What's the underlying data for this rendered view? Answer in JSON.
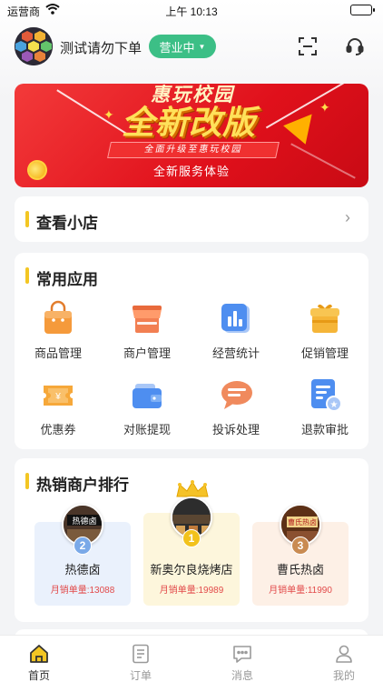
{
  "status_bar": {
    "carrier": "运营商",
    "time": "上午 10:13"
  },
  "header": {
    "store_name": "测试请勿下单",
    "status_label": "营业中"
  },
  "banner": {
    "title_top": "惠玩校园",
    "title_main": "全新改版",
    "ribbon": "全面升级至惠玩校园",
    "subtitle": "全新服务体验"
  },
  "shop_card": {
    "title": "查看小店"
  },
  "apps": {
    "title": "常用应用",
    "items": [
      {
        "label": "商品管理",
        "icon": "shopping-bag-icon"
      },
      {
        "label": "商户管理",
        "icon": "storefront-icon"
      },
      {
        "label": "经营统计",
        "icon": "bar-chart-icon"
      },
      {
        "label": "促销管理",
        "icon": "gift-box-icon"
      },
      {
        "label": "优惠券",
        "icon": "coupon-icon"
      },
      {
        "label": "对账提现",
        "icon": "wallet-icon"
      },
      {
        "label": "投诉处理",
        "icon": "chat-bubble-icon"
      },
      {
        "label": "退款审批",
        "icon": "document-approve-icon"
      }
    ]
  },
  "ranking": {
    "title": "热销商户排行",
    "items": [
      {
        "rank": "2",
        "name": "热德卤",
        "sales": "月销单量:13088"
      },
      {
        "rank": "1",
        "name": "新奥尔良烧烤店",
        "sales": "月销单量:19989"
      },
      {
        "rank": "3",
        "name": "曹氏热卤",
        "sales": "月销单量:11990"
      }
    ]
  },
  "tab_bar": {
    "items": [
      {
        "label": "首页",
        "icon": "home-icon",
        "active": true
      },
      {
        "label": "订单",
        "icon": "order-list-icon",
        "active": false
      },
      {
        "label": "消息",
        "icon": "message-icon",
        "active": false
      },
      {
        "label": "我的",
        "icon": "user-icon",
        "active": false
      }
    ]
  },
  "colors": {
    "accent_green": "#3cbf86",
    "section_marker": "#f3c623",
    "banner_red": "#e0101b",
    "sales_red": "#e24a4a"
  }
}
